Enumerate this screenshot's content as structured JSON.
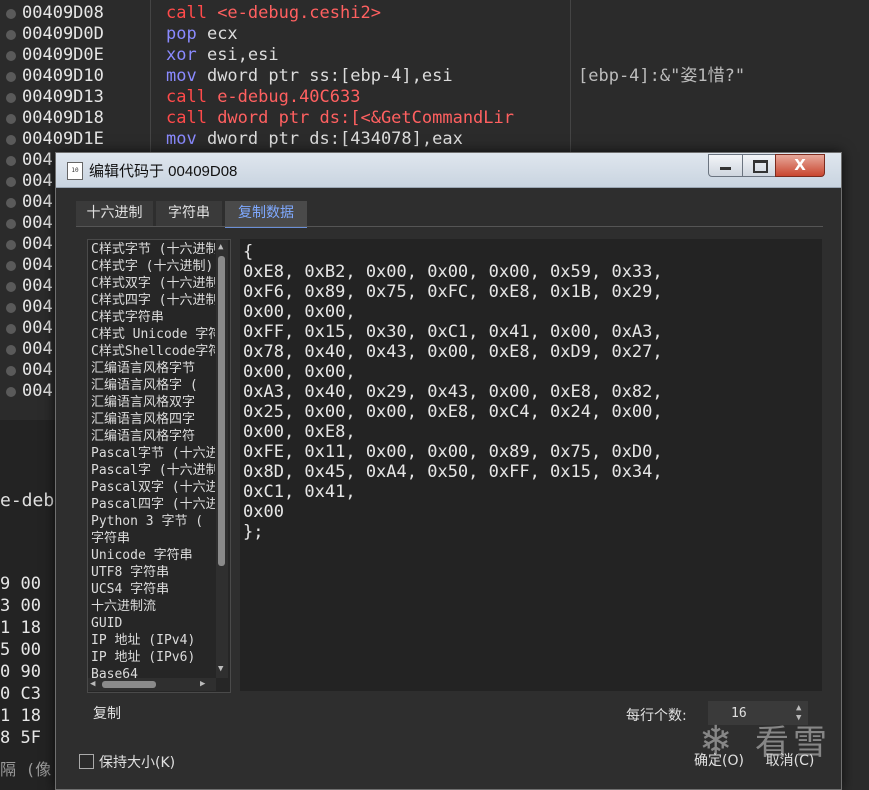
{
  "background": {
    "asm_rows": [
      {
        "addr": "00409D08",
        "mnemonic": "call",
        "operands": "<e-debug.ceshi2>",
        "comment": ""
      },
      {
        "addr": "00409D0D",
        "mnemonic": "pop",
        "operands": "ecx",
        "comment": ""
      },
      {
        "addr": "00409D0E",
        "mnemonic": "xor",
        "operands": "esi,esi",
        "comment": ""
      },
      {
        "addr": "00409D10",
        "mnemonic": "mov",
        "operands": "dword ptr ss:[ebp-4],esi",
        "comment": "[ebp-4]:&\"姿1惜?\""
      },
      {
        "addr": "00409D13",
        "mnemonic": "call",
        "operands": "e-debug.40C633",
        "comment": ""
      },
      {
        "addr": "00409D18",
        "mnemonic": "call",
        "operands": "dword ptr ds:[<&GetCommandLir",
        "comment": ""
      },
      {
        "addr": "00409D1E",
        "mnemonic": "mov",
        "operands": "dword ptr ds:[434078],eax",
        "comment": ""
      }
    ],
    "left_stub_rows": [
      "004",
      "004",
      "004",
      "004",
      "004",
      "004",
      "004",
      "004",
      "004",
      "004",
      "004",
      "004"
    ],
    "label_fragment": "e-debu",
    "hex_rows": [
      "9 00",
      "3 00",
      "1 18",
      "5 00",
      "0 90",
      "0 C3",
      "1 18",
      "8 5F"
    ],
    "status_fragment": "隔 (像"
  },
  "dialog": {
    "title": "编辑代码于 00409D08",
    "close_glyph": "X",
    "tabs": [
      {
        "label": "十六进制",
        "active": false
      },
      {
        "label": "字符串",
        "active": false
      },
      {
        "label": "复制数据",
        "active": true
      }
    ],
    "formats": [
      "C样式字节 (十六进制)",
      "C样式字 (十六进制)",
      "C样式双字 (十六进制)",
      "C样式四字 (十六进制)",
      "C样式字符串",
      "C样式 Unicode 字符串",
      "C样式Shellcode字符串",
      "汇编语言风格字节",
      "汇编语言风格字 (",
      "汇编语言风格双字",
      "汇编语言风格四字",
      "汇编语言风格字符",
      "Pascal字节 (十六进制)",
      "Pascal字 (十六进制)",
      "Pascal双字 (十六进制)",
      "Pascal四字 (十六进制)",
      "Python 3 字节 (",
      "字符串",
      "Unicode 字符串",
      "UTF8 字符串",
      "UCS4 字符串",
      "十六进制流",
      "GUID",
      "IP 地址 (IPv4)",
      "IP 地址 (IPv6)",
      "Base64"
    ],
    "code_lines": [
      "{",
      "0xE8, 0xB2, 0x00, 0x00, 0x00, 0x59, 0x33,",
      "0xF6, 0x89, 0x75, 0xFC, 0xE8, 0x1B, 0x29,",
      "0x00, 0x00,",
      "0xFF, 0x15, 0x30, 0xC1, 0x41, 0x00, 0xA3,",
      "0x78, 0x40, 0x43, 0x00, 0xE8, 0xD9, 0x27,",
      "0x00, 0x00,",
      "0xA3, 0x40, 0x29, 0x43, 0x00, 0xE8, 0x82,",
      "0x25, 0x00, 0x00, 0xE8, 0xC4, 0x24, 0x00,",
      "0x00, 0xE8,",
      "0xFE, 0x11, 0x00, 0x00, 0x89, 0x75, 0xD0,",
      "0x8D, 0x45, 0xA4, 0x50, 0xFF, 0x15, 0x34,",
      "0xC1, 0x41,",
      "0x00",
      "};"
    ],
    "copy_label": "复制",
    "per_line_label": "每行个数:",
    "per_line_value": "16",
    "keep_size_label": "保持大小(K)",
    "keep_size_checked": false,
    "ok_label": "确定(O)",
    "cancel_label": "取消(C)"
  },
  "watermark": {
    "text": "看雪",
    "icon": "snowflake-icon"
  }
}
